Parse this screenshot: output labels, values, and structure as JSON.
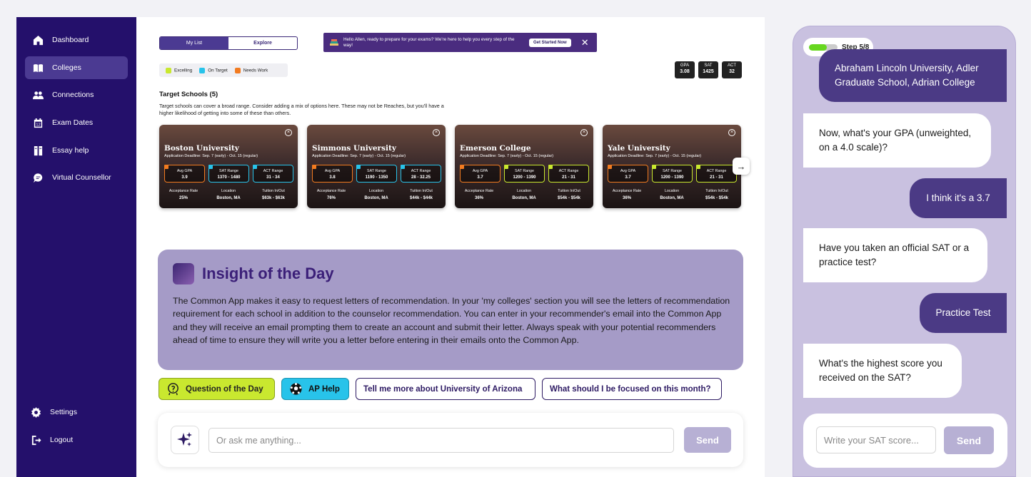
{
  "sidebar": {
    "items": [
      {
        "label": "Dashboard",
        "icon": "home-icon"
      },
      {
        "label": "Colleges",
        "icon": "book-icon"
      },
      {
        "label": "Connections",
        "icon": "people-icon"
      },
      {
        "label": "Exam Dates",
        "icon": "calendar-icon"
      },
      {
        "label": "Essay help",
        "icon": "essay-icon"
      },
      {
        "label": "Virtual Counsellor",
        "icon": "chat-icon"
      }
    ],
    "settings": "Settings",
    "logout": "Logout"
  },
  "tabs": {
    "my_list": "My List",
    "explore": "Explore"
  },
  "banner": {
    "text": "Hello Allen, ready to prepare for your exams? We're here to help you every step of the way!",
    "button": "Get Started Now",
    "close": "✕"
  },
  "legend": {
    "excelling": "Excelling",
    "on_target": "On Target",
    "needs_work": "Needs Work"
  },
  "colors": {
    "excelling": "#c9e82f",
    "on_target": "#28c3ea",
    "needs_work": "#f27b20",
    "brand": "#24106b"
  },
  "scores": {
    "gpa": {
      "label": "GPA",
      "value": "3.08"
    },
    "sat": {
      "label": "SAT",
      "value": "1425"
    },
    "act": {
      "label": "ACT",
      "value": "32"
    }
  },
  "target": {
    "title": "Target Schools (5)",
    "desc": "Target schools can cover a broad range. Consider adding a mix of options here. These may not be Reaches, but you'll have a higher likelihood of getting into some of these than others."
  },
  "card_labels": {
    "gpa": "Avg GPA",
    "sat": "SAT Range",
    "act": "ACT Range",
    "acc": "Acceptance Rate",
    "loc": "Location",
    "tuition": "Tuition In/Out"
  },
  "cards": [
    {
      "name": "Boston University",
      "deadline": "Application Deadline: Sep. 7 (early) - Oct. 15 (regular)",
      "gpa": "3.9",
      "sat": "1370 - 1480",
      "act": "31 - 34",
      "acc": "25%",
      "loc": "Boston, MA",
      "tuition": "$63k - $63k",
      "gpa_status": "needs_work",
      "sat_status": "on_target",
      "act_status": "on_target"
    },
    {
      "name": "Simmons University",
      "deadline": "Application Deadline: Sep. 7 (early) - Oct. 15 (regular)",
      "gpa": "3.8",
      "sat": "1190 - 1350",
      "act": "28 - 32.25",
      "acc": "76%",
      "loc": "Boston, MA",
      "tuition": "$44k - $44k",
      "gpa_status": "needs_work",
      "sat_status": "on_target",
      "act_status": "on_target"
    },
    {
      "name": "Emerson College",
      "deadline": "Application Deadline: Sep. 7 (early) - Oct. 15 (regular)",
      "gpa": "3.7",
      "sat": "1200 - 1390",
      "act": "21 - 31",
      "acc": "36%",
      "loc": "Boston, MA",
      "tuition": "$54k - $54k",
      "gpa_status": "needs_work",
      "sat_status": "excelling",
      "act_status": "excelling"
    },
    {
      "name": "Yale University",
      "deadline": "Application Deadline: Sep. 7 (early) - Oct. 15 (regular)",
      "gpa": "3.7",
      "sat": "1200 - 1390",
      "act": "21 - 31",
      "acc": "36%",
      "loc": "Boston, MA",
      "tuition": "$54k - $54k",
      "gpa_status": "needs_work",
      "sat_status": "excelling",
      "act_status": "excelling"
    }
  ],
  "insight": {
    "title": "Insight of the Day",
    "body": "The Common App makes it easy to request letters of recommendation. In your 'my colleges' section you will see the letters of recommendation requirement for each school in addition to the counselor recommendation. You can enter in your recommender's email into the Common App and they will receive an email prompting them to create an account and submit their letter. Always speak with your potential recommenders ahead of time to ensure they will write you a letter before entering in their emails onto the Common App."
  },
  "chips": {
    "question": "Question of the Day",
    "ap": "AP Help",
    "arizona": "Tell me more about University of Arizona",
    "focus": "What should I be focused on this month?"
  },
  "ask": {
    "placeholder": "Or ask me anything...",
    "send": "Send"
  },
  "chat": {
    "step_label": "Step 5/8",
    "step_progress": 0.625,
    "messages": [
      {
        "from": "user",
        "text": "Abraham Lincoln University, Adler Graduate School, Adrian College"
      },
      {
        "from": "bot",
        "text": "Now, what's your GPA (unweighted, on a 4.0 scale)?"
      },
      {
        "from": "user",
        "text": "I think it's a 3.7"
      },
      {
        "from": "bot",
        "text": "Have you taken an official SAT or a practice test?"
      },
      {
        "from": "user",
        "text": "Practice Test"
      },
      {
        "from": "bot",
        "text": "What's the highest score you received on the SAT?"
      }
    ],
    "placeholder": "Write your SAT score...",
    "send": "Send"
  }
}
